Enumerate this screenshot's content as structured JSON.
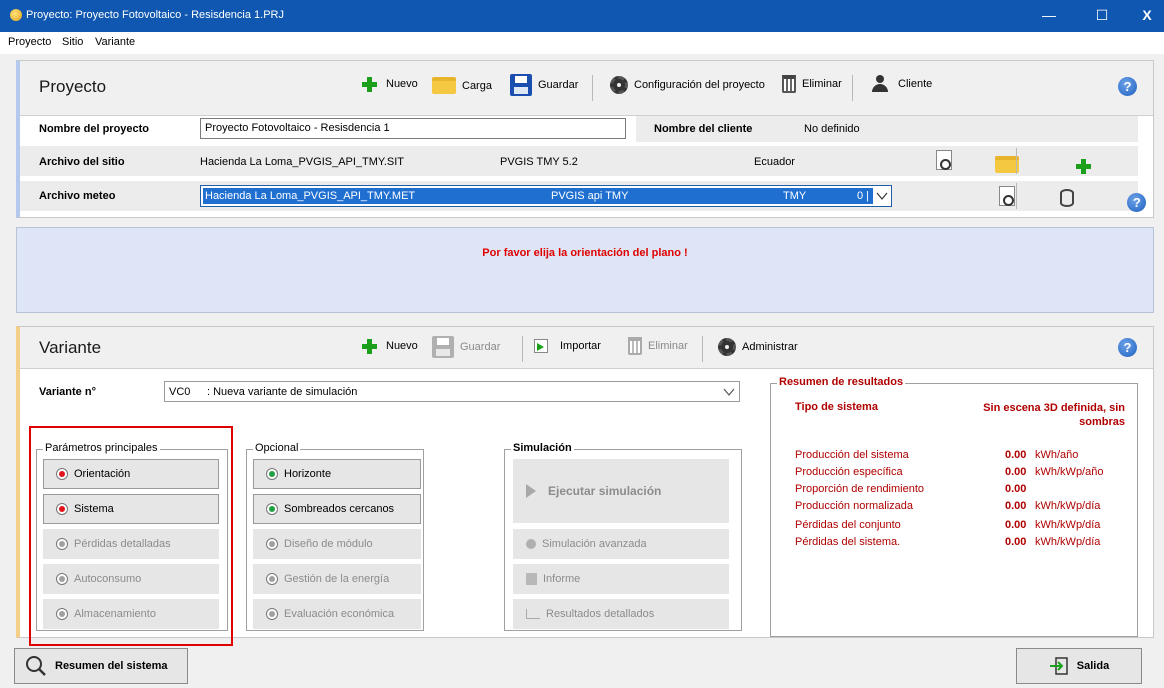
{
  "window": {
    "title": "Proyecto: Proyecto Fotovoltaico - Resisdencia 1.PRJ",
    "minimize": "—",
    "maximize": "☐",
    "close": "X"
  },
  "menu": [
    "Proyecto",
    "Sitio",
    "Variante"
  ],
  "project": {
    "section_title": "Proyecto",
    "toolbar": {
      "new": "Nuevo",
      "load": "Carga",
      "save": "Guardar",
      "config": "Configuración del proyecto",
      "delete": "Eliminar",
      "client": "Cliente"
    },
    "name_label": "Nombre del proyecto",
    "name_value": "Proyecto Fotovoltaico - Resisdencia 1",
    "client_label": "Nombre del cliente",
    "client_value": "No definido",
    "site_label": "Archivo del sitio",
    "site_file": "Hacienda La Loma_PVGIS_API_TMY.SIT",
    "site_source": "PVGIS TMY 5.2",
    "site_country": "Ecuador",
    "meteo_label": "Archivo meteo",
    "meteo_file": "Hacienda La Loma_PVGIS_API_TMY.MET",
    "meteo_source": "PVGIS api TMY",
    "meteo_type": "TMY",
    "meteo_extra": "0 |"
  },
  "message": "Por favor elija la orientación del plano !",
  "variant": {
    "section_title": "Variante",
    "toolbar": {
      "new": "Nuevo",
      "save": "Guardar",
      "import": "Importar",
      "delete": "Eliminar",
      "manage": "Administrar"
    },
    "number_label": "Variante n°",
    "number_code": "VC0",
    "number_desc": ": Nueva variante de simulación",
    "main_params": {
      "title": "Parámetros principales",
      "items": [
        {
          "label": "Orientación",
          "state": "red"
        },
        {
          "label": "Sistema",
          "state": "red"
        },
        {
          "label": "Pérdidas detalladas",
          "state": "gray"
        },
        {
          "label": "Autoconsumo",
          "state": "gray"
        },
        {
          "label": "Almacenamiento",
          "state": "gray"
        }
      ]
    },
    "optional": {
      "title": "Opcional",
      "items": [
        {
          "label": "Horizonte",
          "state": "green"
        },
        {
          "label": "Sombreados cercanos",
          "state": "green"
        },
        {
          "label": "Diseño de módulo",
          "state": "gray"
        },
        {
          "label": "Gestión de la energía",
          "state": "gray"
        },
        {
          "label": "Evaluación económica",
          "state": "gray"
        }
      ]
    },
    "simulation": {
      "title": "Simulación",
      "run": "Ejecutar simulación",
      "advanced": "Simulación avanzada",
      "report": "Informe",
      "detailed": "Resultados detallados"
    },
    "results": {
      "title": "Resumen de resultados",
      "system_type_label": "Tipo de sistema",
      "system_type_value": "Sin escena 3D definida, sin sombras",
      "rows": [
        {
          "label": "Producción del sistema",
          "value": "0.00",
          "unit": "kWh/año"
        },
        {
          "label": "Producción específica",
          "value": "0.00",
          "unit": "kWh/kWp/año"
        },
        {
          "label": "Proporción de rendimiento",
          "value": "0.00",
          "unit": ""
        },
        {
          "label": "Producción normalizada",
          "value": "0.00",
          "unit": "kWh/kWp/día"
        },
        {
          "label": "Pérdidas del conjunto",
          "value": "0.00",
          "unit": "kWh/kWp/día"
        },
        {
          "label": "Pérdidas del sistema.",
          "value": "0.00",
          "unit": "kWh/kWp/día"
        }
      ]
    }
  },
  "footer": {
    "summary": "Resumen del sistema",
    "exit": "Salida"
  },
  "colors": {
    "titlebar": "#0f57b0",
    "results_red": "#b00000",
    "highlight_box": "#e00000"
  }
}
